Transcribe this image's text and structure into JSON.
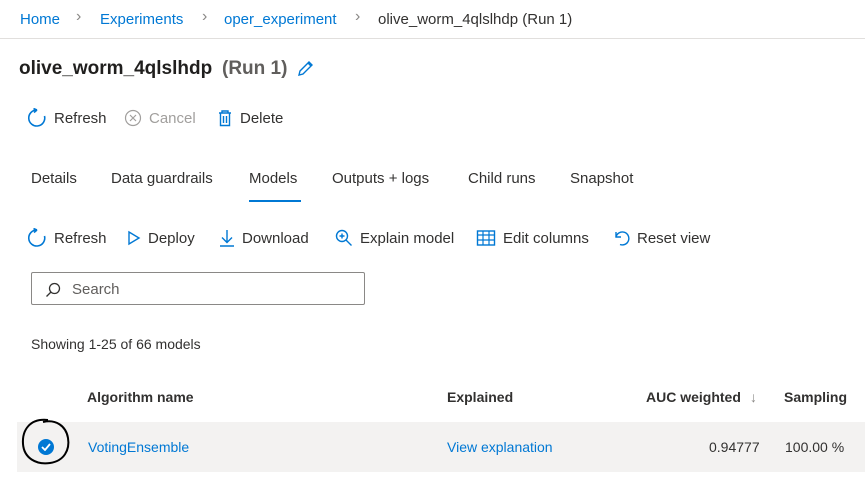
{
  "breadcrumb": {
    "home": "Home",
    "experiments": "Experiments",
    "experiment": "oper_experiment",
    "current": "olive_worm_4qlslhdp (Run 1)"
  },
  "page": {
    "title": "olive_worm_4qlslhdp",
    "subtitle": "(Run 1)"
  },
  "run_commands": {
    "refresh": "Refresh",
    "cancel": "Cancel",
    "delete": "Delete"
  },
  "tabs": [
    {
      "label": "Details"
    },
    {
      "label": "Data guardrails"
    },
    {
      "label": "Models"
    },
    {
      "label": "Outputs + logs"
    },
    {
      "label": "Child runs"
    },
    {
      "label": "Snapshot"
    }
  ],
  "active_tab": "Models",
  "model_commands": {
    "refresh": "Refresh",
    "deploy": "Deploy",
    "download": "Download",
    "explain": "Explain model",
    "edit_columns": "Edit columns",
    "reset_view": "Reset view"
  },
  "search": {
    "placeholder": "Search",
    "value": ""
  },
  "showing_text": "Showing 1-25 of 66 models",
  "table": {
    "columns": {
      "algorithm": "Algorithm name",
      "explained": "Explained",
      "auc": "AUC weighted",
      "sampling": "Sampling"
    },
    "sort_icon": "arrow-down-icon",
    "rows": [
      {
        "selected": true,
        "algorithm": "VotingEnsemble",
        "explained": "View explanation",
        "auc": "0.94777",
        "sampling": "100.00 %"
      }
    ]
  },
  "colors": {
    "accent": "#0078d4",
    "text": "#323130",
    "row_bg": "#f3f2f1"
  }
}
